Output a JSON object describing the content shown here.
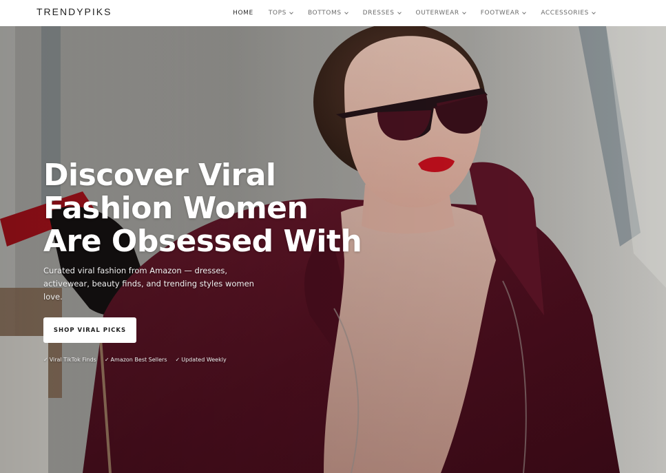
{
  "header": {
    "logo": "TRENDYPIKS",
    "nav": [
      {
        "label": "HOME",
        "active": true,
        "has_dropdown": false
      },
      {
        "label": "TOPS",
        "active": false,
        "has_dropdown": true
      },
      {
        "label": "BOTTOMS",
        "active": false,
        "has_dropdown": true
      },
      {
        "label": "DRESSES",
        "active": false,
        "has_dropdown": true
      },
      {
        "label": "OUTERWEAR",
        "active": false,
        "has_dropdown": true
      },
      {
        "label": "FOOTWEAR",
        "active": false,
        "has_dropdown": true
      },
      {
        "label": "ACCESSORIES",
        "active": false,
        "has_dropdown": true
      }
    ]
  },
  "hero": {
    "title": "Discover Viral Fashion Women Are Obsessed With",
    "subtitle": "Curated viral fashion from Amazon — dresses, activewear, beauty finds, and trending styles women love.",
    "cta_label": "SHOP VIRAL PICKS",
    "badges": [
      {
        "icon": "check-icon",
        "label": "Viral TikTok Finds"
      },
      {
        "icon": "check-icon",
        "label": "Amazon Best Sellers"
      },
      {
        "icon": "check-icon",
        "label": "Updated Weekly"
      }
    ],
    "image_subject": "hero-photo-woman-sunglasses-burgundy-coat"
  },
  "colors": {
    "header_bg": "#ffffff",
    "nav_text": "#6b6b6b",
    "nav_active": "#2b2b2b",
    "hero_text": "#ffffff",
    "cta_bg": "#ffffff",
    "cta_text": "#1a1a1a",
    "coat": "#5a1426",
    "lips": "#c8101e"
  }
}
